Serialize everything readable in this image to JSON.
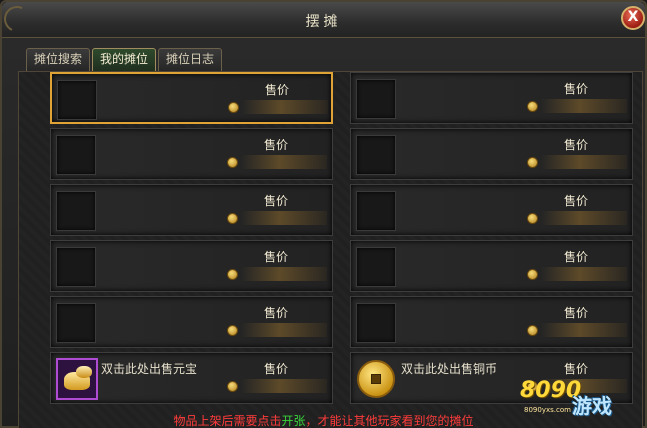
{
  "window": {
    "title": "摆摊",
    "close_label": "X"
  },
  "tabs": [
    {
      "label": "摊位搜索",
      "active": false
    },
    {
      "label": "我的摊位",
      "active": true
    },
    {
      "label": "摊位日志",
      "active": false
    }
  ],
  "slots": {
    "price_label": "售价",
    "gold_ingot_label": "双击此处出售元宝",
    "copper_coin_label": "双击此处出售铜币",
    "selected_index": 0,
    "count": 12
  },
  "footer": {
    "before": "物品上架后需要点击",
    "highlight": "开张",
    "after": "，才能让其他玩家看到您的摊位"
  },
  "watermark": {
    "number": "8090",
    "url": "8090yxs.com",
    "text": "游戏"
  },
  "colors": {
    "selected_border": "#e0a436",
    "footer_red": "#ff3b3b",
    "footer_green": "#38d33c"
  }
}
